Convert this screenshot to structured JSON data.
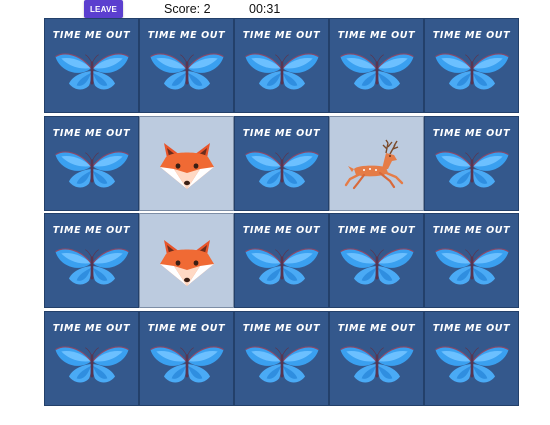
{
  "header": {
    "leave_label": "LEAVE",
    "score_text": "Score: 2",
    "timer_text": "00:31"
  },
  "card_back_text": "TIME ME OUT",
  "colors": {
    "card_back": "#34588c",
    "card_face": "#bccbdf",
    "leave_button": "#5b3fcf"
  },
  "grid": {
    "rows": 4,
    "cols": 5,
    "cards": [
      [
        "back",
        "back",
        "back",
        "back",
        "back"
      ],
      [
        "back",
        "fox",
        "back",
        "deer",
        "back"
      ],
      [
        "back",
        "fox",
        "back",
        "back",
        "back"
      ],
      [
        "back",
        "back",
        "back",
        "back",
        "back"
      ]
    ]
  }
}
